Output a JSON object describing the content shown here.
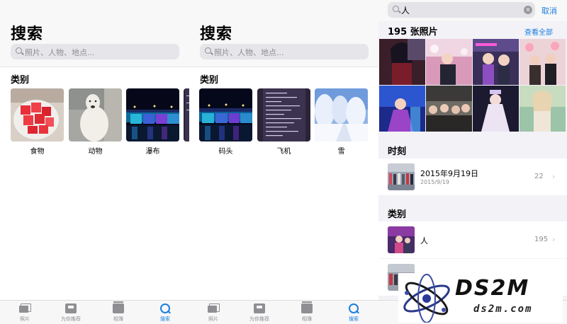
{
  "screens": [
    {
      "title": "搜索",
      "search_placeholder": "照片、人物、地点...",
      "section_title": "类别",
      "categories": [
        {
          "label": "食物",
          "icon": "watermelon-photo"
        },
        {
          "label": "动物",
          "icon": "polar-bear-photo"
        },
        {
          "label": "瀑布",
          "icon": "night-bridge-photo"
        }
      ]
    },
    {
      "title": "搜索",
      "search_placeholder": "照片、人物、地点...",
      "section_title": "类别",
      "categories": [
        {
          "label": "码头",
          "icon": "night-bridge-photo"
        },
        {
          "label": "飞机",
          "icon": "terminal-screen-photo"
        },
        {
          "label": "雪",
          "icon": "snow-trees-photo"
        }
      ]
    }
  ],
  "tabbar": {
    "items": [
      {
        "label": "照片",
        "icon": "photos-icon"
      },
      {
        "label": "为你推荐",
        "icon": "for-you-icon"
      },
      {
        "label": "相簿",
        "icon": "albums-icon"
      },
      {
        "label": "搜索",
        "icon": "search-icon",
        "active": true
      }
    ]
  },
  "results": {
    "query": "人",
    "cancel_label": "取消",
    "photos_header": "195 张照片",
    "see_all_label": "查看全部",
    "moments_header": "时刻",
    "moment": {
      "title": "2015年9月19日",
      "subtitle": "2015/9/19",
      "count": "22"
    },
    "categories_header": "类别",
    "category_rows": [
      {
        "title": "人",
        "count": "195"
      },
      {
        "title": "人群",
        "count": "19"
      }
    ]
  },
  "watermark": {
    "logo_text": "DS2M",
    "url_text": "ds2m.com"
  },
  "colors": {
    "accent": "#1a7ee0",
    "secondary_text": "#8e8e93",
    "background_grouped": "#f2f2f7"
  }
}
